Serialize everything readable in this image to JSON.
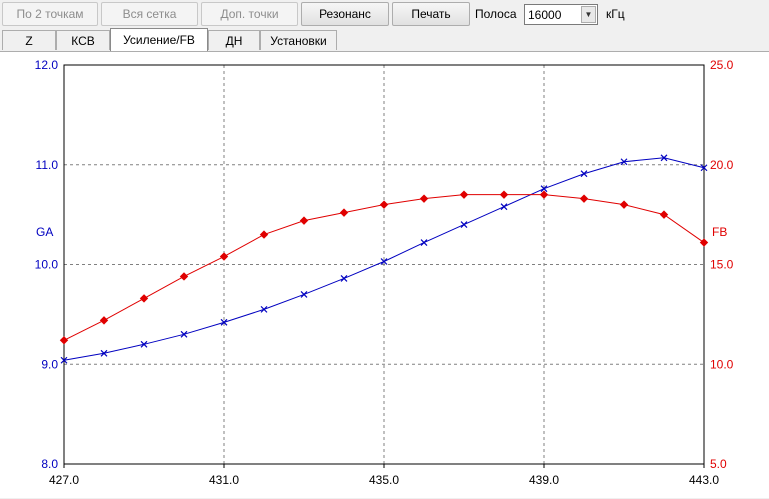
{
  "toolbar": {
    "btn_two_points": "По 2 точкам",
    "btn_full_grid": "Вся сетка",
    "btn_extra_points": "Доп. точки",
    "btn_resonance": "Резонанс",
    "btn_print": "Печать",
    "band_label": "Полоса",
    "band_value": "16000",
    "unit_label": "кГц"
  },
  "tabs": [
    "Z",
    "КСВ",
    "Усиление/FB",
    "ДН",
    "Установки"
  ],
  "active_tab": "Усиление/FB",
  "colors": {
    "ga": "#0000c0",
    "fb": "#e00000",
    "grid": "#808080"
  },
  "chart_data": {
    "type": "line",
    "xlim": [
      427.0,
      443.0
    ],
    "x_ticks": [
      "427.0",
      "431.0",
      "435.0",
      "439.0",
      "443.0"
    ],
    "y_left": {
      "label": "GA",
      "range": [
        8.0,
        12.0
      ],
      "ticks": [
        "8.0",
        "9.0",
        "10.0",
        "11.0",
        "12.0"
      ]
    },
    "y_right": {
      "label": "FB",
      "range": [
        5.0,
        25.0
      ],
      "ticks": [
        "5.0",
        "10.0",
        "15.0",
        "20.0",
        "25.0"
      ]
    },
    "grid": true,
    "series": [
      {
        "name": "GA",
        "axis": "left",
        "marker": "x",
        "x": [
          427,
          428,
          429,
          430,
          431,
          432,
          433,
          434,
          435,
          436,
          437,
          438,
          439,
          440,
          441,
          442,
          443
        ],
        "y": [
          9.04,
          9.11,
          9.2,
          9.3,
          9.42,
          9.55,
          9.7,
          9.86,
          10.03,
          10.22,
          10.4,
          10.58,
          10.76,
          10.91,
          11.03,
          11.07,
          10.97
        ]
      },
      {
        "name": "FB",
        "axis": "right",
        "marker": "diamond",
        "x": [
          427,
          428,
          429,
          430,
          431,
          432,
          433,
          434,
          435,
          436,
          437,
          438,
          439,
          440,
          441,
          442,
          443
        ],
        "y": [
          11.2,
          12.2,
          13.3,
          14.4,
          15.4,
          16.5,
          17.2,
          17.6,
          18.0,
          18.3,
          18.5,
          18.5,
          18.5,
          18.3,
          18.0,
          17.5,
          16.1
        ]
      }
    ]
  }
}
